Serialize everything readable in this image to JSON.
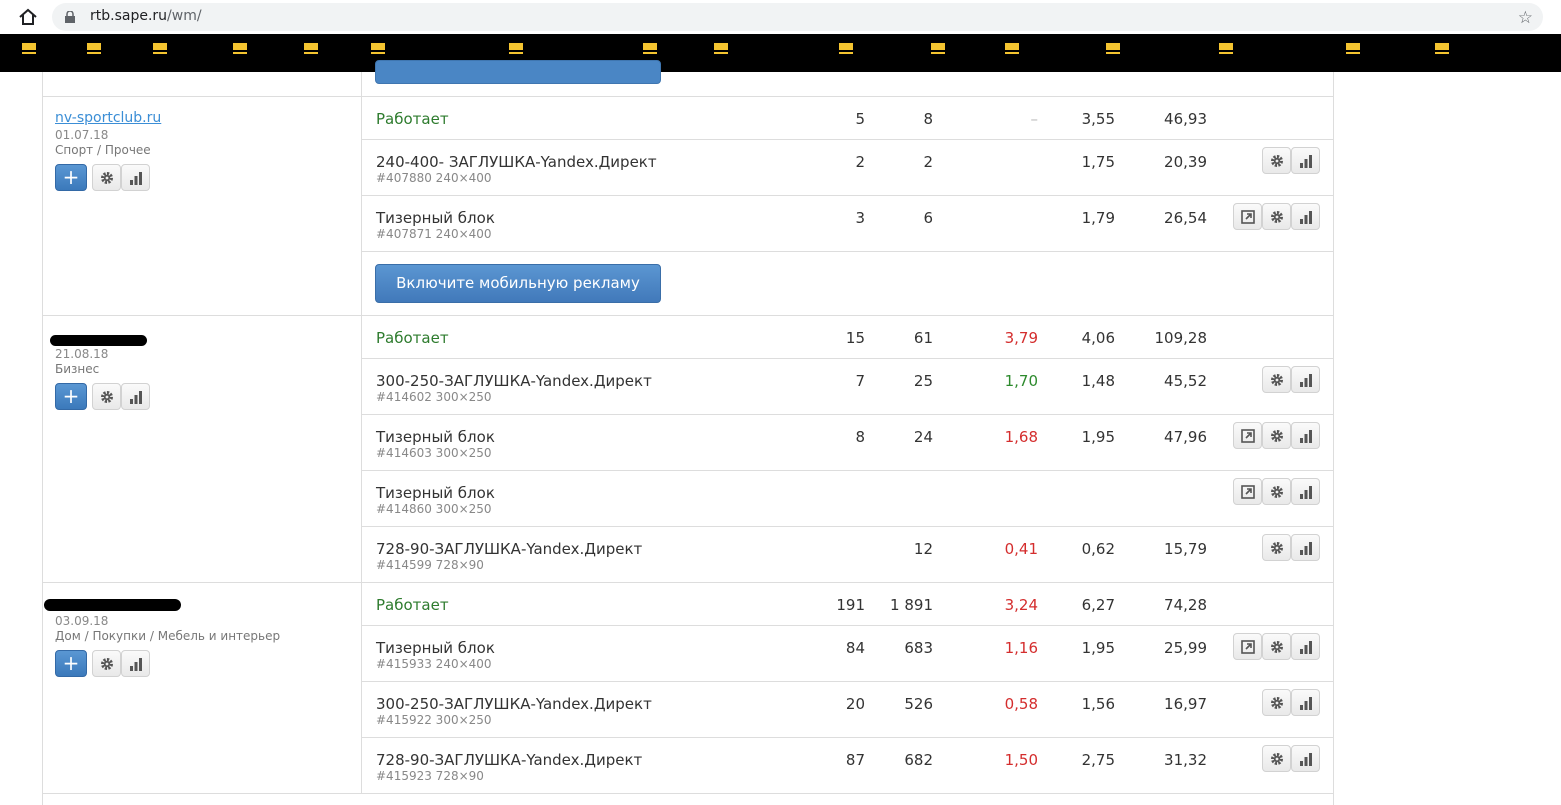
{
  "browser": {
    "url_host": "rtb.sape.ru",
    "url_path": "/wm/"
  },
  "mobile_button_label": "Включите мобильную рекламу",
  "sites": [
    {
      "name": "nv-sportclub.ru",
      "date": "01.07.18",
      "category": "Спорт / Прочее",
      "summary": {
        "status": "Работает",
        "c1": "5",
        "c2": "8",
        "c3": "–",
        "c4": "3,55",
        "c5": "46,93"
      },
      "blocks": [
        {
          "name": "240-400- ЗАГЛУШКА-Yandex.Директ",
          "sub": "#407880 240×400",
          "c1": "2",
          "c2": "2",
          "c3": "",
          "c4": "1,75",
          "c5": "20,39"
        },
        {
          "name": "Тизерный блок",
          "sub": "#407871 240×400",
          "c1": "3",
          "c2": "6",
          "c3": "",
          "c4": "1,79",
          "c5": "26,54"
        }
      ]
    },
    {
      "name": "",
      "date": "21.08.18",
      "category": "Бизнес",
      "summary": {
        "status": "Работает",
        "c1": "15",
        "c2": "61",
        "c3": "3,79",
        "c4": "4,06",
        "c5": "109,28"
      },
      "blocks": [
        {
          "name": "300-250-ЗАГЛУШКА-Yandex.Директ",
          "sub": "#414602 300×250",
          "c1": "7",
          "c2": "25",
          "c3": "1,70",
          "c4": "1,48",
          "c5": "45,52"
        },
        {
          "name": "Тизерный блок",
          "sub": "#414603 300×250",
          "c1": "8",
          "c2": "24",
          "c3": "1,68",
          "c4": "1,95",
          "c5": "47,96"
        },
        {
          "name": "Тизерный блок",
          "sub": "#414860 300×250",
          "c1": "",
          "c2": "",
          "c3": "",
          "c4": "",
          "c5": ""
        },
        {
          "name": "728-90-ЗАГЛУШКА-Yandex.Директ",
          "sub": "#414599 728×90",
          "c1": "",
          "c2": "12",
          "c3": "0,41",
          "c4": "0,62",
          "c5": "15,79"
        }
      ]
    },
    {
      "name": "",
      "date": "03.09.18",
      "category": "Дом / Покупки / Мебель и интерьер",
      "summary": {
        "status": "Работает",
        "c1": "191",
        "c2": "1 891",
        "c3": "3,24",
        "c4": "6,27",
        "c5": "74,28"
      },
      "blocks": [
        {
          "name": "Тизерный блок",
          "sub": "#415933 240×400",
          "c1": "84",
          "c2": "683",
          "c3": "1,16",
          "c4": "1,95",
          "c5": "25,99"
        },
        {
          "name": "300-250-ЗАГЛУШКА-Yandex.Директ",
          "sub": "#415922 300×250",
          "c1": "20",
          "c2": "526",
          "c3": "0,58",
          "c4": "1,56",
          "c5": "16,97"
        },
        {
          "name": "728-90-ЗАГЛУШКА-Yandex.Директ",
          "sub": "#415923 728×90",
          "c1": "87",
          "c2": "682",
          "c3": "1,50",
          "c4": "2,75",
          "c5": "31,32"
        }
      ]
    }
  ]
}
